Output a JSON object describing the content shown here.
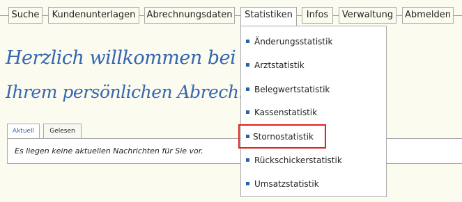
{
  "nav": {
    "items": [
      {
        "label": "Suche"
      },
      {
        "label": "Kundenunterlagen"
      },
      {
        "label": "Abrechnungsdaten"
      },
      {
        "label": "Statistiken"
      },
      {
        "label": "Infos"
      },
      {
        "label": "Verwaltung"
      },
      {
        "label": "Abmelden"
      }
    ],
    "active": "Statistiken"
  },
  "welcome": {
    "line1": "Herzlich willkommen bei der DZH,",
    "line2": "Ihrem persönlichen Abrechnungshaus"
  },
  "messages": {
    "tabs": [
      {
        "label": "Aktuell"
      },
      {
        "label": "Gelesen"
      }
    ],
    "empty_text": "Es liegen keine aktuellen Nachrichten für Sie vor."
  },
  "statistics_menu": {
    "items": [
      {
        "label": "Änderungsstatistik"
      },
      {
        "label": "Arztstatistik"
      },
      {
        "label": "Belegwertstatistik"
      },
      {
        "label": "Kassenstatistik"
      },
      {
        "label": "Stornostatistik"
      },
      {
        "label": "Rückschickerstatistik"
      },
      {
        "label": "Umsatzstatistik"
      }
    ],
    "highlighted": "Stornostatistik",
    "bullet_color": "#2d5fa8",
    "highlight_color": "#e02020"
  },
  "colors": {
    "background": "#fbfbef",
    "accent": "#3566b0"
  }
}
